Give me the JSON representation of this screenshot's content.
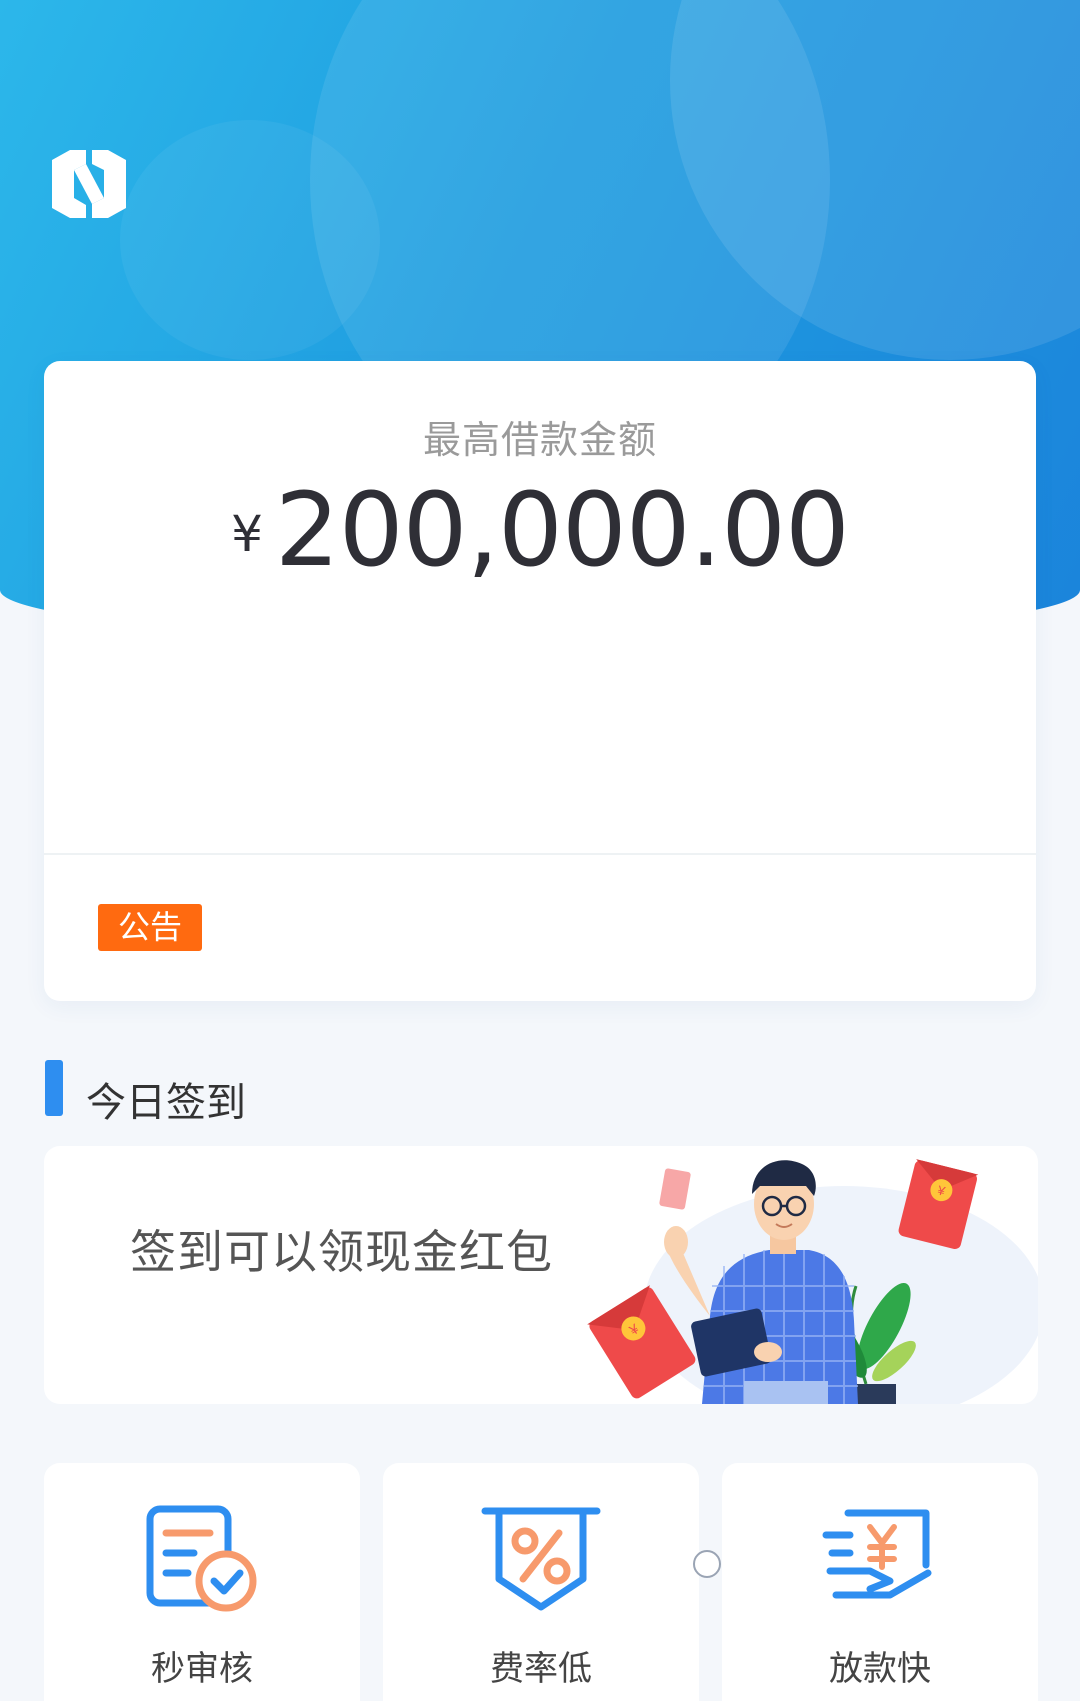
{
  "hero": {
    "logo_icon": "app-logo-icon",
    "gradient_colors": [
      "#2cb7ea",
      "#1b84db"
    ]
  },
  "loan_card": {
    "label": "最高借款金额",
    "currency_symbol": "¥",
    "amount": "200,000.00"
  },
  "notice": {
    "badge": "公告",
    "badge_color": "#ff6a10"
  },
  "signin_section": {
    "title": "今日签到",
    "banner_text": "签到可以领现金红包"
  },
  "features": [
    {
      "label": "秒审核",
      "icon": "review-check-icon"
    },
    {
      "label": "费率低",
      "icon": "low-rate-percent-icon"
    },
    {
      "label": "放款快",
      "icon": "fast-loan-money-icon"
    }
  ],
  "colors": {
    "accent_blue": "#2e8ef0",
    "icon_orange": "#f79a6c"
  }
}
